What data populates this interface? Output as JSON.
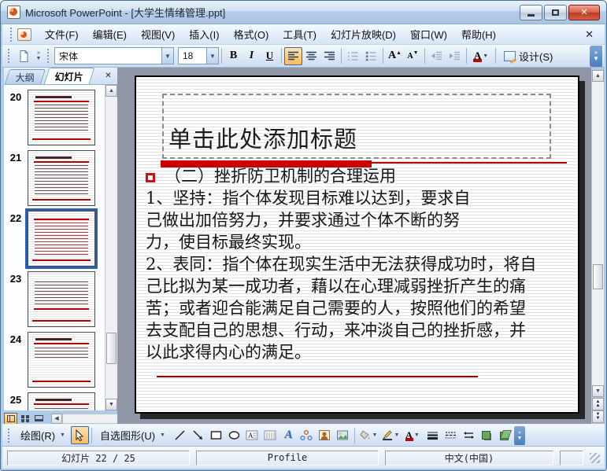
{
  "window": {
    "title": "Microsoft PowerPoint - [大学生情绪管理.ppt]"
  },
  "menu": {
    "items": [
      "文件(F)",
      "编辑(E)",
      "视图(V)",
      "插入(I)",
      "格式(O)",
      "工具(T)",
      "幻灯片放映(D)",
      "窗口(W)",
      "帮助(H)"
    ],
    "close_label": "✕"
  },
  "toolbar": {
    "font_name": "宋体",
    "font_size": "18",
    "bold": "B",
    "italic": "I",
    "underline": "U",
    "design_label": "设计(S)"
  },
  "panel": {
    "outline_tab": "大纲",
    "slides_tab": "幻灯片",
    "close_label": "✕",
    "thumbnails": [
      {
        "number": "20"
      },
      {
        "number": "21"
      },
      {
        "number": "22",
        "selected": true
      },
      {
        "number": "23"
      },
      {
        "number": "24"
      },
      {
        "number": "25"
      }
    ],
    "selected_slide": "22"
  },
  "slide": {
    "title_placeholder": "单击此处添加标题",
    "bullet_line": "（二）挫折防卫机制的合理运用",
    "body_lines": [
      "1、坚持：指个体发现目标难以达到，要求自",
      "己做出加倍努力，并要求通过个体不断的努",
      "力，使目标最终实现。",
      "2、表同：指个体在现实生活中无法获得成功时，将自",
      "己比拟为某一成功者，藉以在心理减弱挫折产生的痛",
      "苦；或者迎合能满足自己需要的人，按照他们的希望",
      "去支配自己的思想、行动，来冲淡自己的挫折感，并",
      "以此求得内心的满足。"
    ]
  },
  "drawbar": {
    "draw_label": "绘图(R)",
    "autoshapes_label": "自选图形(U)"
  },
  "status": {
    "slide_indicator": "幻灯片 22 / 25",
    "template_name": "Profile",
    "language": "中文(中国)"
  },
  "colors": {
    "accent_red": "#cc0000",
    "selection_blue": "#2b5ead",
    "highlight_orange": "#fbb95c",
    "editor_gray": "#8f96a6"
  }
}
